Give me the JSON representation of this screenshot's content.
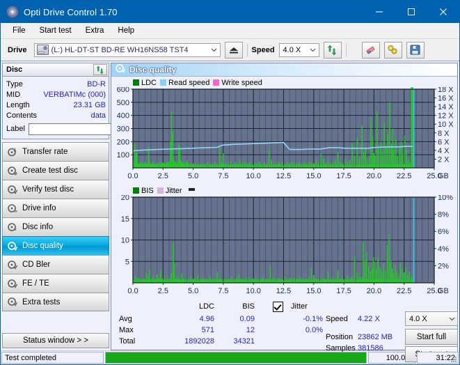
{
  "window": {
    "title": "Opti Drive Control 1.70",
    "app_icon": "disc-icon",
    "minimize": "minimize-icon",
    "maximize": "maximize-icon",
    "close": "close-icon",
    "accent": "#0063b1"
  },
  "menu": {
    "items": [
      "File",
      "Start test",
      "Extra",
      "Help"
    ]
  },
  "toolbar": {
    "drive_label": "Drive",
    "drive_value": "(L:) HL-DT-ST BD-RE  WH16NS58 TST4",
    "eject_icon": "eject-icon",
    "speed_label": "Speed",
    "speed_value": "4.0 X",
    "refresh_icon": "refresh-icon",
    "erase_icon": "eraser-icon",
    "tools_icon": "tools-icon",
    "save_icon": "save-icon"
  },
  "disc_panel": {
    "title": "Disc",
    "refresh_icon": "refresh-icon",
    "rows": [
      {
        "key": "Type",
        "value": "BD-R"
      },
      {
        "key": "MID",
        "value": "VERBATIMc (000)"
      },
      {
        "key": "Length",
        "value": "23.31 GB"
      },
      {
        "key": "Contents",
        "value": "data"
      }
    ],
    "label_key": "Label",
    "label_value": "",
    "label_placeholder": "",
    "disc_icon": "cd-icon"
  },
  "nav": {
    "items": [
      {
        "label": "Transfer rate",
        "icon": "disc-transfer-icon",
        "selected": false
      },
      {
        "label": "Create test disc",
        "icon": "disc-create-icon",
        "selected": false
      },
      {
        "label": "Verify test disc",
        "icon": "disc-verify-icon",
        "selected": false
      },
      {
        "label": "Drive info",
        "icon": "disc-drive-icon",
        "selected": false
      },
      {
        "label": "Disc info",
        "icon": "disc-info-icon",
        "selected": false
      },
      {
        "label": "Disc quality",
        "icon": "disc-quality-icon",
        "selected": true
      },
      {
        "label": "CD Bler",
        "icon": "disc-bler-icon",
        "selected": false
      },
      {
        "label": "FE / TE",
        "icon": "disc-fete-icon",
        "selected": false
      },
      {
        "label": "Extra tests",
        "icon": "disc-extra-icon",
        "selected": false
      }
    ],
    "status_window": "Status window > >"
  },
  "content": {
    "title": "Disc quality",
    "icon": "disc-quality-icon"
  },
  "chart_data": [
    {
      "type": "line",
      "name": "ldc-chart",
      "title": "",
      "xlabel": "GB",
      "ylabel": "",
      "xlim": [
        0,
        25.0
      ],
      "xticks": [
        "0.0",
        "2.5",
        "5.0",
        "7.5",
        "10.0",
        "12.5",
        "15.0",
        "17.5",
        "20.0",
        "22.5",
        "25.0"
      ],
      "ylim": [
        0,
        600
      ],
      "yticks": [
        "600",
        "500",
        "400",
        "300",
        "200",
        "100"
      ],
      "y2lim": [
        0,
        18
      ],
      "y2ticks": [
        "18 X",
        "16 X",
        "14 X",
        "12 X",
        "10 X",
        "8 X",
        "6 X",
        "4 X",
        "2 X"
      ],
      "grid": true,
      "legend_position": "top-left",
      "legend": [
        {
          "label": "LDC",
          "color": "#008000"
        },
        {
          "label": "Read speed",
          "color": "#87cefa"
        },
        {
          "label": "Write speed",
          "color": "#ff66cc"
        }
      ],
      "series": [
        {
          "name": "LDC",
          "color": "#1fd01f",
          "kind": "impulse",
          "x": [
            0.05,
            0.15,
            0.25,
            0.33,
            0.4,
            0.5,
            0.6,
            0.7,
            0.8,
            0.9,
            1.0,
            1.1,
            1.2,
            1.3,
            1.4,
            1.5,
            1.6,
            1.7,
            1.8,
            1.9,
            2.0,
            2.1,
            2.2,
            2.3,
            2.4,
            2.5,
            2.6,
            2.7,
            2.8,
            2.9,
            3.0,
            3.1,
            3.2,
            3.3,
            3.4,
            3.5,
            3.6,
            3.7,
            3.8,
            3.9,
            4.0,
            4.1,
            4.2,
            4.3,
            4.4,
            4.5,
            4.6,
            4.8,
            5.0,
            5.2,
            5.4,
            5.6,
            5.8,
            6.0,
            6.2,
            6.4,
            6.6,
            6.8,
            7.0,
            7.2,
            7.35,
            7.5,
            7.7,
            7.9,
            8.1,
            8.3,
            8.5,
            8.7,
            8.9,
            9.1,
            9.3,
            9.5,
            9.7,
            9.9,
            10.1,
            10.3,
            10.5,
            10.7,
            10.9,
            11.1,
            11.3,
            11.5,
            11.7,
            11.9,
            12.05,
            12.2,
            12.4,
            12.6,
            12.8,
            13.0,
            13.2,
            13.4,
            13.6,
            13.8,
            14.0,
            14.2,
            14.4,
            14.6,
            14.8,
            15.0,
            15.2,
            15.4,
            15.6,
            15.8,
            16.0,
            16.2,
            16.4,
            16.6,
            16.8,
            17.0,
            17.2,
            17.4,
            17.6,
            17.8,
            18.0,
            18.2,
            18.4,
            18.6,
            18.8,
            19.0,
            19.15,
            19.3,
            19.45,
            19.6,
            19.75,
            19.9,
            20.0,
            20.1,
            20.25,
            20.4,
            20.55,
            20.7,
            20.85,
            21.0,
            21.15,
            21.3,
            21.45,
            21.55,
            21.65,
            21.8,
            21.95,
            22.1,
            22.25,
            22.4,
            22.55,
            22.7,
            22.85,
            23.0,
            23.1,
            23.2
          ],
          "y": [
            40,
            190,
            110,
            120,
            35,
            30,
            50,
            40,
            35,
            30,
            45,
            30,
            35,
            160,
            50,
            30,
            35,
            45,
            25,
            30,
            35,
            40,
            30,
            35,
            45,
            40,
            30,
            35,
            40,
            50,
            45,
            200,
            430,
            270,
            60,
            50,
            35,
            45,
            180,
            160,
            55,
            40,
            45,
            35,
            40,
            55,
            35,
            30,
            35,
            30,
            35,
            30,
            35,
            30,
            40,
            35,
            30,
            45,
            35,
            160,
            45,
            110,
            35,
            40,
            55,
            30,
            45,
            35,
            60,
            40,
            50,
            35,
            45,
            30,
            40,
            35,
            50,
            30,
            45,
            35,
            140,
            60,
            35,
            30,
            50,
            35,
            45,
            30,
            40,
            35,
            50,
            45,
            35,
            40,
            30,
            45,
            35,
            50,
            40,
            35,
            60,
            45,
            110,
            70,
            40,
            55,
            35,
            45,
            60,
            120,
            50,
            35,
            75,
            45,
            60,
            190,
            90,
            230,
            80,
            320,
            120,
            150,
            60,
            90,
            380,
            240,
            110,
            90,
            430,
            150,
            200,
            120,
            350,
            160,
            260,
            500,
            180,
            300,
            130,
            220,
            90,
            160,
            200,
            110,
            250,
            140,
            60,
            40
          ]
        },
        {
          "name": "Read speed",
          "color": "#8fd8f8",
          "kind": "line",
          "x": [
            0.0,
            1.0,
            2.0,
            3.0,
            4.0,
            5.0,
            6.0,
            7.0,
            7.4,
            8.5,
            9.5,
            10.5,
            11.5,
            12.5,
            13.0,
            14.0,
            14.6,
            15.5,
            16.3,
            17.0,
            17.6,
            18.5,
            19.5,
            20.2,
            21.0,
            22.0,
            22.6,
            23.2
          ],
          "y": [
            3.9,
            4.1,
            4.2,
            4.3,
            4.4,
            4.5,
            4.6,
            4.7,
            5.2,
            5.4,
            5.5,
            5.6,
            5.7,
            5.8,
            4.2,
            4.2,
            4.3,
            4.3,
            4.6,
            4.6,
            4.5,
            4.5,
            4.5,
            4.7,
            4.8,
            4.8,
            4.9,
            4.9
          ],
          "unit": "X"
        }
      ],
      "marker_line": {
        "x": 23.3,
        "color": "#35c8f0"
      }
    },
    {
      "type": "line",
      "name": "bis-chart",
      "title": "",
      "xlabel": "GB",
      "ylabel": "",
      "xlim": [
        0,
        25.0
      ],
      "xticks": [
        "0.0",
        "2.5",
        "5.0",
        "7.5",
        "10.0",
        "12.5",
        "15.0",
        "17.5",
        "20.0",
        "22.5",
        "25.0"
      ],
      "ylim": [
        0,
        20
      ],
      "yticks": [
        "20",
        "15",
        "10",
        "5"
      ],
      "y2lim": [
        0,
        10
      ],
      "y2ticks": [
        "10%",
        "8%",
        "6%",
        "4%",
        "2%"
      ],
      "grid": true,
      "legend_position": "top-left",
      "legend": [
        {
          "label": "BIS",
          "color": "#008000"
        },
        {
          "label": "Jitter",
          "color": "#d8b4dd"
        }
      ],
      "series": [
        {
          "name": "BIS",
          "color": "#1fd01f",
          "kind": "impulse",
          "x": [
            0.05,
            0.2,
            0.35,
            0.5,
            0.65,
            0.8,
            0.95,
            1.1,
            1.25,
            1.4,
            1.55,
            1.7,
            1.85,
            2.0,
            2.15,
            2.3,
            2.45,
            2.6,
            2.75,
            2.9,
            3.05,
            3.2,
            3.35,
            3.45,
            3.6,
            3.75,
            3.9,
            4.05,
            4.2,
            4.4,
            4.6,
            4.8,
            5.0,
            5.2,
            5.4,
            5.6,
            5.8,
            6.0,
            6.2,
            6.4,
            6.6,
            6.8,
            7.0,
            7.2,
            7.4,
            7.6,
            7.8,
            8.0,
            8.2,
            8.4,
            8.6,
            8.8,
            9.0,
            9.2,
            9.4,
            9.6,
            9.8,
            10.0,
            10.2,
            10.4,
            10.6,
            10.8,
            11.0,
            11.2,
            11.4,
            11.6,
            11.8,
            12.0,
            12.2,
            12.4,
            12.6,
            12.8,
            13.0,
            13.2,
            13.4,
            13.6,
            13.8,
            14.0,
            14.2,
            14.4,
            14.6,
            14.8,
            15.0,
            15.2,
            15.4,
            15.6,
            15.8,
            16.0,
            16.2,
            16.4,
            16.6,
            16.8,
            17.0,
            17.2,
            17.4,
            17.6,
            17.8,
            18.0,
            18.2,
            18.4,
            18.6,
            18.8,
            19.0,
            19.1,
            19.25,
            19.4,
            19.55,
            19.7,
            19.85,
            19.95,
            20.05,
            20.2,
            20.35,
            20.5,
            20.65,
            20.8,
            20.95,
            21.1,
            21.25,
            21.4,
            21.5,
            21.6,
            21.75,
            21.9,
            22.05,
            22.2,
            22.35,
            22.5,
            22.65,
            22.8,
            22.95,
            23.1,
            23.2
          ],
          "y": [
            0.5,
            1.6,
            0.9,
            1.2,
            0.7,
            0.9,
            1.0,
            2.4,
            1.6,
            3.2,
            0.9,
            1.3,
            0.8,
            2.0,
            1.1,
            2.7,
            1.0,
            1.5,
            0.8,
            1.2,
            1.0,
            2.4,
            9.2,
            4.6,
            1.1,
            1.4,
            0.9,
            2.2,
            1.1,
            0.8,
            1.0,
            1.3,
            0.9,
            1.1,
            1.8,
            0.9,
            1.2,
            1.0,
            0.8,
            1.5,
            1.1,
            0.9,
            2.6,
            1.2,
            0.9,
            1.1,
            0.8,
            1.0,
            1.4,
            0.9,
            1.2,
            2.0,
            1.0,
            0.9,
            1.3,
            1.1,
            0.8,
            1.0,
            1.2,
            0.9,
            1.1,
            1.4,
            0.9,
            1.0,
            3.9,
            1.2,
            0.9,
            1.1,
            1.0,
            0.8,
            1.3,
            0.9,
            1.1,
            1.0,
            1.2,
            0.9,
            1.4,
            1.1,
            0.9,
            1.0,
            1.3,
            3.4,
            1.8,
            1.0,
            0.9,
            1.2,
            1.1,
            0.9,
            2.6,
            1.0,
            1.3,
            1.1,
            2.8,
            1.0,
            1.2,
            0.9,
            1.6,
            1.1,
            1.3,
            6.2,
            2.4,
            1.5,
            1.2,
            9.4,
            5.4,
            7.2,
            4.0,
            2.8,
            3.4,
            6.0,
            4.8,
            3.2,
            5.8,
            3.6,
            2.6,
            4.4,
            3.0,
            8.6,
            11.2,
            5.2,
            3.4,
            2.2,
            4.0,
            2.8,
            1.8,
            4.6,
            3.2,
            2.4,
            3.6,
            2.0,
            2.6,
            1.4,
            0.8
          ]
        }
      ],
      "marker_line": {
        "x": 23.3,
        "color": "#35c8f0"
      }
    }
  ],
  "stats": {
    "col_ldc": "LDC",
    "col_bis": "BIS",
    "jitter_label": "Jitter",
    "jitter_checked": true,
    "rows": [
      {
        "name": "Avg",
        "ldc": "4.96",
        "bis": "0.09",
        "jitter": "-0.1%"
      },
      {
        "name": "Max",
        "ldc": "571",
        "bis": "12",
        "jitter": "0.0%"
      },
      {
        "name": "Total",
        "ldc": "1892028",
        "bis": "34321",
        "jitter": ""
      }
    ],
    "speed_label": "Speed",
    "speed_value": "4.22 X",
    "position_label": "Position",
    "position_value": "23862 MB",
    "samples_label": "Samples",
    "samples_value": "381586",
    "speed_select": "4.0 X",
    "start_full": "Start full",
    "start_part": "Start part"
  },
  "statusbar": {
    "message": "Test completed",
    "progress_percent": 100,
    "percent_text": "100.0%",
    "elapsed": "31:22",
    "progress_color": "#16a916"
  }
}
